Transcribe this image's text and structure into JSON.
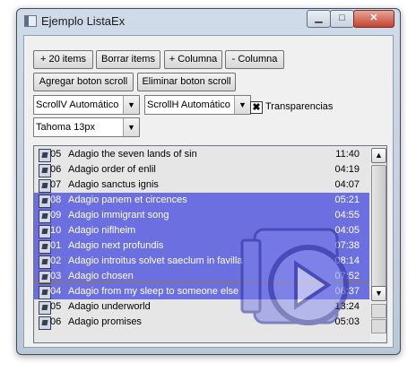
{
  "window": {
    "title": "Ejemplo ListaEx",
    "icons": {
      "app": "app-window-icon",
      "minimize": "minimize-icon",
      "maximize": "maximize-icon",
      "close": "close-icon"
    },
    "caption_glyphs": {
      "minimize": "▁",
      "maximize": "□",
      "close": "✕"
    }
  },
  "toolbar": {
    "add_items": "+ 20 items",
    "clear_items": "Borrar items",
    "add_column": "+ Columna",
    "remove_column": "- Columna",
    "add_scroll_button": "Agregar boton scroll",
    "remove_scroll_button": "Eliminar boton scroll"
  },
  "options": {
    "scrollv": "ScrollV Automático",
    "scrollh": "ScrollH Automático",
    "transparencias_label": "Transparencias",
    "transparencias_checked": true,
    "check_glyph": "✖",
    "font": "Tahoma 13px",
    "dropdown_glyph": "▼"
  },
  "list": {
    "row_icon": "music-note-icon",
    "watermark_icon": "play-icon",
    "colors": {
      "selection": "#6c6fe0",
      "selection_text": "#ffffff"
    },
    "rows": [
      {
        "num": "05",
        "name": "Adagio the seven lands of sin",
        "time": "11:40",
        "selected": false
      },
      {
        "num": "06",
        "name": "Adagio order of enlil",
        "time": "04:19",
        "selected": false
      },
      {
        "num": "07",
        "name": "Adagio sanctus ignis",
        "time": "04:07",
        "selected": false
      },
      {
        "num": "08",
        "name": "Adagio panem et circences",
        "time": "05:21",
        "selected": true
      },
      {
        "num": "09",
        "name": "Adagio immigrant song",
        "time": "04:55",
        "selected": true
      },
      {
        "num": "10",
        "name": "Adagio niflheim",
        "time": "04:05",
        "selected": true
      },
      {
        "num": "01",
        "name": "Adagio next profundis",
        "time": "07:38",
        "selected": true
      },
      {
        "num": "02",
        "name": "Adagio introitus solvet saeclum in favilla",
        "time": "08:14",
        "selected": true
      },
      {
        "num": "03",
        "name": "Adagio chosen",
        "time": "07:52",
        "selected": true
      },
      {
        "num": "04",
        "name": "Adagio from my sleep to someone else",
        "time": "06:37",
        "selected": true
      },
      {
        "num": "05",
        "name": "Adagio underworld",
        "time": "13:24",
        "selected": false
      },
      {
        "num": "06",
        "name": "Adagio promises",
        "time": "05:03",
        "selected": false
      }
    ]
  },
  "scrollbar": {
    "up_glyph": "▲",
    "down_glyph": "▼"
  }
}
